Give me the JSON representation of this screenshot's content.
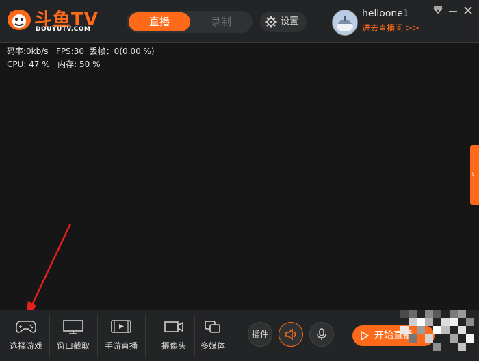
{
  "app": {
    "brand": "斗鱼TV",
    "brand_sub": "DOUYUTV.COM"
  },
  "header": {
    "tabs": [
      {
        "label": "直播",
        "active": true
      },
      {
        "label": "录制",
        "active": false
      }
    ],
    "settings_label": "设置"
  },
  "user": {
    "name": "helloone1",
    "enter_live": "进去直播间 >>"
  },
  "stats": {
    "line1": "码率:0kb/s   FPS:30  丢帧：0(0.00 %)",
    "line2": "CPU: 47 %   内存: 50 %"
  },
  "toolbar": {
    "tools": [
      {
        "label": "选择游戏",
        "icon": "gamepad-icon"
      },
      {
        "label": "窗口截取",
        "icon": "monitor-icon"
      },
      {
        "label": "手游直播",
        "icon": "mobile-play-icon"
      },
      {
        "label": "摄像头",
        "icon": "camera-icon"
      },
      {
        "label": "多媒体",
        "icon": "media-icon"
      }
    ],
    "plugin_label": "插件",
    "speaker_icon": "speaker-icon",
    "mic_icon": "microphone-icon",
    "start_label": "开始直播"
  },
  "colors": {
    "accent": "#ff6a1a",
    "background": "#161616",
    "bar": "#222426"
  }
}
